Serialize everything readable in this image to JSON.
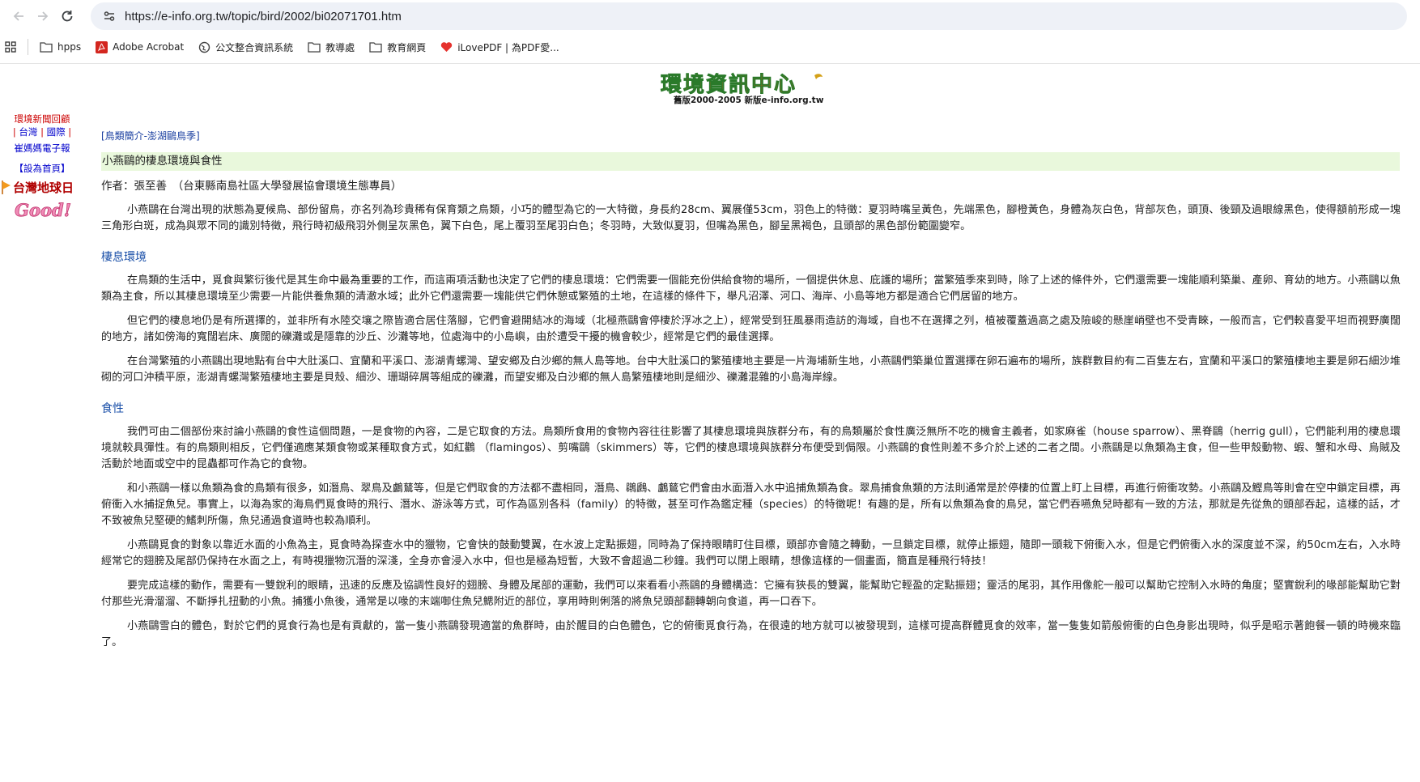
{
  "browser": {
    "url": "https://e-info.org.tw/topic/bird/2002/bi02071701.htm",
    "bookmarks": [
      {
        "label": "hpps",
        "icon": "folder-icon"
      },
      {
        "label": "Adobe Acrobat",
        "icon": "acrobat-icon"
      },
      {
        "label": "公文整合資訊系統",
        "icon": "globe-icon"
      },
      {
        "label": "教導處",
        "icon": "folder-icon"
      },
      {
        "label": "教育網頁",
        "icon": "folder-icon"
      },
      {
        "label": "iLovePDF | 為PDF愛...",
        "icon": "heart-icon"
      }
    ]
  },
  "logo": {
    "title": "環境資訊中心",
    "subtitle": "舊版2000-2005 新版e-info.org.tw"
  },
  "sidebar": {
    "news_title": "環境新聞回顧",
    "region_taiwan": "台灣",
    "region_international": "國際",
    "epaper": "崔媽媽電子報",
    "set_homepage": "【設為首頁】",
    "earthday": "台灣地球日",
    "good": "Good!"
  },
  "article": {
    "breadcrumb": "[鳥類簡介-澎湖鷗鳥季]",
    "title": "小燕鷗的棲息環境與食性",
    "author": "作者：張至善　（台東縣南島社區大學發展協會環境生態專員）",
    "intro": "小燕鷗在台灣出現的狀態為夏候鳥、部份留鳥，亦名列為珍貴稀有保育類之鳥類，小巧的體型為它的一大特徵，身長約28cm、翼展僅53cm，羽色上的特徵：夏羽時嘴呈黃色，先端黑色，腳橙黃色，身體為灰白色，背部灰色，頭頂、後頸及過眼線黑色，使得額前形成一塊三角形白斑，成為與眾不同的識別特徵，飛行時初級飛羽外側呈灰黑色，翼下白色，尾上覆羽至尾羽白色；冬羽時，大致似夏羽，但嘴為黑色，腳呈黑褐色，且頭部的黑色部份範圍變窄。",
    "habitat_heading": "棲息環境",
    "habitat_p1": "在鳥類的生活中，覓食與繁衍後代是其生命中最為重要的工作，而這兩項活動也決定了它們的棲息環境：它們需要一個能充份供給食物的場所，一個提供休息、庇護的場所；當繁殖季來到時，除了上述的條件外，它們還需要一塊能順利築巢、產卵、育幼的地方。小燕鷗以魚類為主食，所以其棲息環境至少需要一片能供養魚類的清澈水域；此外它們還需要一塊能供它們休憩或繁殖的土地，在這樣的條件下，舉凡沼澤、河口、海岸、小島等地方都是適合它們居留的地方。",
    "habitat_p2": "但它們的棲息地仍是有所選擇的，並非所有水陸交壤之際皆適合居住落腳，它們會避開結冰的海域（北極燕鷗會停棲於浮冰之上），經常受到狂風暴雨造訪的海域，自也不在選擇之列，植被覆蓋過高之處及險峻的懸崖峭壁也不受青睞，一般而言，它們較喜愛平坦而視野廣闊的地方，諸如傍海的寬闊岩床、廣闊的礫灘或是隱靠的沙丘、沙灘等地，位處海中的小島嶼，由於遭受干擾的機會較少，經常是它們的最佳選擇。",
    "habitat_p3": "在台灣繁殖的小燕鷗出現地點有台中大肚溪口、宜蘭和平溪口、澎湖青螺灣、望安鄉及白沙鄉的無人島等地。台中大肚溪口的繁殖棲地主要是一片海埔新生地，小燕鷗們築巢位置選擇在卵石遍布的場所，族群數目約有二百隻左右，宜蘭和平溪口的繁殖棲地主要是卵石細沙堆砌的河口沖積平原，澎湖青螺灣繁殖棲地主要是貝殼、細沙、珊瑚碎屑等組成的礫灘，而望安鄉及白沙鄉的無人島繁殖棲地則是細沙、礫灘混雜的小島海岸線。",
    "diet_heading": "食性",
    "diet_p1": "我們可由二個部份來討論小燕鷗的食性這個問題，一是食物的內容，二是它取食的方法。鳥類所食用的食物內容往往影響了其棲息環境與族群分布，有的鳥類屬於食性廣泛無所不吃的機會主義者，如家麻雀（house sparrow）、黑脊鷗（herrig gull），它們能利用的棲息環境就較具彈性。有的鳥類則相反，它們僅適應某類食物或某種取食方式，如紅鸛 （flamingos）、剪嘴鷗（skimmers）等，它們的棲息環境與族群分布便受到侷限。小燕鷗的食性則差不多介於上述的二者之間。小燕鷗是以魚類為主食，但一些甲殼動物、蝦、蟹和水母、烏賊及活動於地面或空中的昆蟲都可作為它的食物。",
    "diet_p2": "和小燕鷗一樣以魚類為食的鳥類有很多，如潛鳥、翠鳥及鸕鶿等，但是它們取食的方法都不盡相同，潛鳥、鸊鷉、鸕鶿它們會由水面潛入水中追捕魚類為食。翠鳥捕食魚類的方法則通常是於停棲的位置上盯上目標，再進行俯衝攻勢。小燕鷗及鰹鳥等則會在空中鎖定目標，再俯衝入水捕捉魚兒。事實上，以海為家的海鳥們覓食時的飛行、潛水、游泳等方式，可作為區別各科（family）的特徵，甚至可作為鑑定種（species）的特徵呢！有趣的是，所有以魚類為食的鳥兒，當它們吞嚥魚兒時都有一致的方法，那就是先從魚的頭部吞起，這樣的話，才不致被魚兒堅硬的鰭刺所傷，魚兒通過食道時也較為順利。",
    "diet_p3": "小燕鷗覓食的對象以靠近水面的小魚為主，覓食時為探查水中的獵物，它會快的鼓動雙翼，在水波上定點振翅，同時為了保持眼睛盯住目標，頭部亦會隨之轉動，一旦鎖定目標，就停止振翅，隨即一頭栽下俯衝入水，但是它們俯衝入水的深度並不深，約50cm左右，入水時經常它的翅膀及尾部仍保持在水面之上，有時視獵物沉潛的深淺，全身亦會浸入水中，但也是極為短暫，大致不會超過二秒鐘。我們可以閉上眼睛，想像這樣的一個畫面，簡直是種飛行特技！",
    "diet_p4": "要完成這樣的動作，需要有一雙銳利的眼睛，迅速的反應及協調性良好的翅膀、身體及尾部的運動，我們可以來看看小燕鷗的身體構造：它擁有狹長的雙翼，能幫助它輕盈的定點振翅；靈活的尾羽，其作用像舵一般可以幫助它控制入水時的角度；堅實銳利的喙部能幫助它對付那些光滑溜溜、不斷掙扎扭動的小魚。捕獲小魚後，通常是以喙的末端啣住魚兒鰓附近的部位，享用時則俐落的將魚兒頭部翻轉朝向食道，再一口吞下。",
    "diet_p5": "小燕鷗雪白的體色，對於它們的覓食行為也是有貢獻的，當一隻小燕鷗發現適當的魚群時，由於醒目的白色體色，它的俯衝覓食行為，在很遠的地方就可以被發現到，這樣可提高群體覓食的效率，當一隻隻如箭般俯衝的白色身影出現時，似乎是昭示著飽餐一頓的時機來臨了。"
  }
}
